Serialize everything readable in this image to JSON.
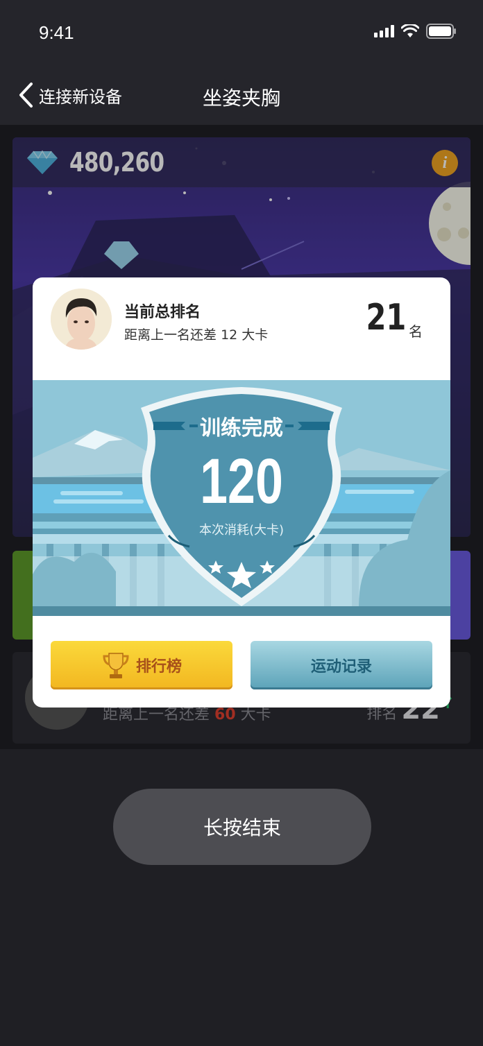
{
  "status_bar": {
    "time": "9:41"
  },
  "nav": {
    "back_label": "连接新设备",
    "title": "坐姿夹胸"
  },
  "game": {
    "gem_count": "480,260",
    "info_symbol": "i"
  },
  "background_row": {
    "diff_prefix": "距离上一名还差",
    "diff_value": "60",
    "diff_unit": "大卡",
    "rank_label": "排名",
    "rank_value": "22",
    "arrow": "↑"
  },
  "modal": {
    "rank_title": "当前总排名",
    "rank_sub_prefix": "距离上一名还差",
    "rank_sub_value": "12",
    "rank_sub_unit": "大卡",
    "rank_number": "21",
    "rank_unit": "名",
    "shield_title": "训练完成",
    "shield_value": "120",
    "shield_label": "本次消耗(大卡)",
    "buttons": {
      "leaderboard": "排行榜",
      "records": "运动记录"
    }
  },
  "end_button": {
    "label": "长按结束"
  },
  "colors": {
    "accent_yellow": "#f2b620",
    "accent_teal": "#5ba2b8",
    "info_orange": "#f2a623"
  }
}
